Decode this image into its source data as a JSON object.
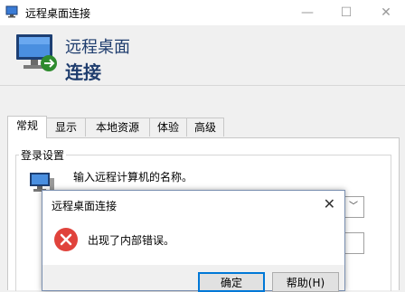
{
  "window": {
    "title": "远程桌面连接",
    "minimize_glyph": "—",
    "maximize_glyph": "☐",
    "close_glyph": "✕"
  },
  "banner": {
    "line1": "远程桌面",
    "line2": "连接",
    "icon": "remote-desktop-icon"
  },
  "tabs": [
    {
      "label": "常规",
      "active": true
    },
    {
      "label": "显示"
    },
    {
      "label": "本地资源"
    },
    {
      "label": "体验"
    },
    {
      "label": "高级"
    }
  ],
  "general": {
    "group_label": "登录设置",
    "hint": "输入远程计算机的名称。",
    "combo_arrow": "﹀"
  },
  "dialog": {
    "title": "远程桌面连接",
    "close_glyph": "✕",
    "message": "出现了内部错误。",
    "icon": "error-icon",
    "ok_label": "确定",
    "help_label": "帮助(H)"
  },
  "colors": {
    "banner_text": "#1f3d6e",
    "error_red": "#e0433c",
    "default_button_border": "#0078d7"
  }
}
